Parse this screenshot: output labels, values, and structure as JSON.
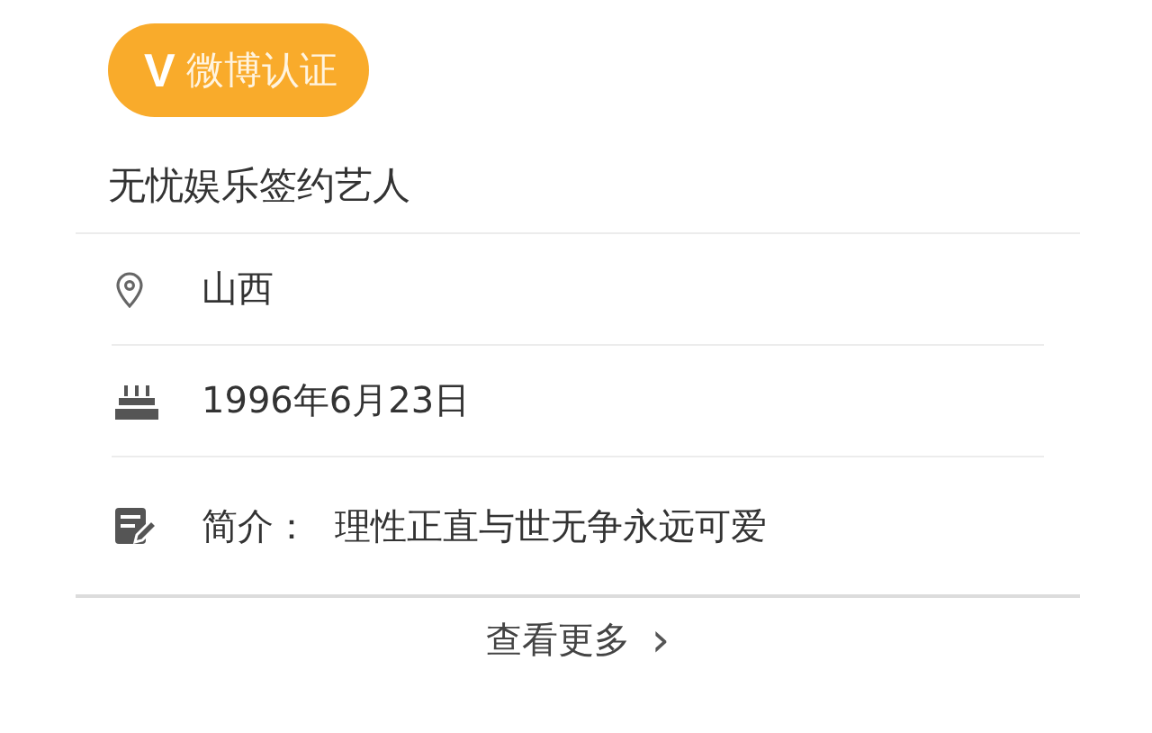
{
  "badge": {
    "icon_text": "V",
    "label": "微博认证"
  },
  "title": "无忧娱乐签约艺人",
  "info_rows": [
    {
      "kind": "location",
      "text": "山西"
    },
    {
      "kind": "birthday",
      "text": "1996年6月23日"
    },
    {
      "kind": "intro",
      "label": "简介：",
      "text": "理性正直与世无争永远可爱"
    }
  ],
  "more_link": {
    "label": "查看更多",
    "arrow": "›"
  }
}
